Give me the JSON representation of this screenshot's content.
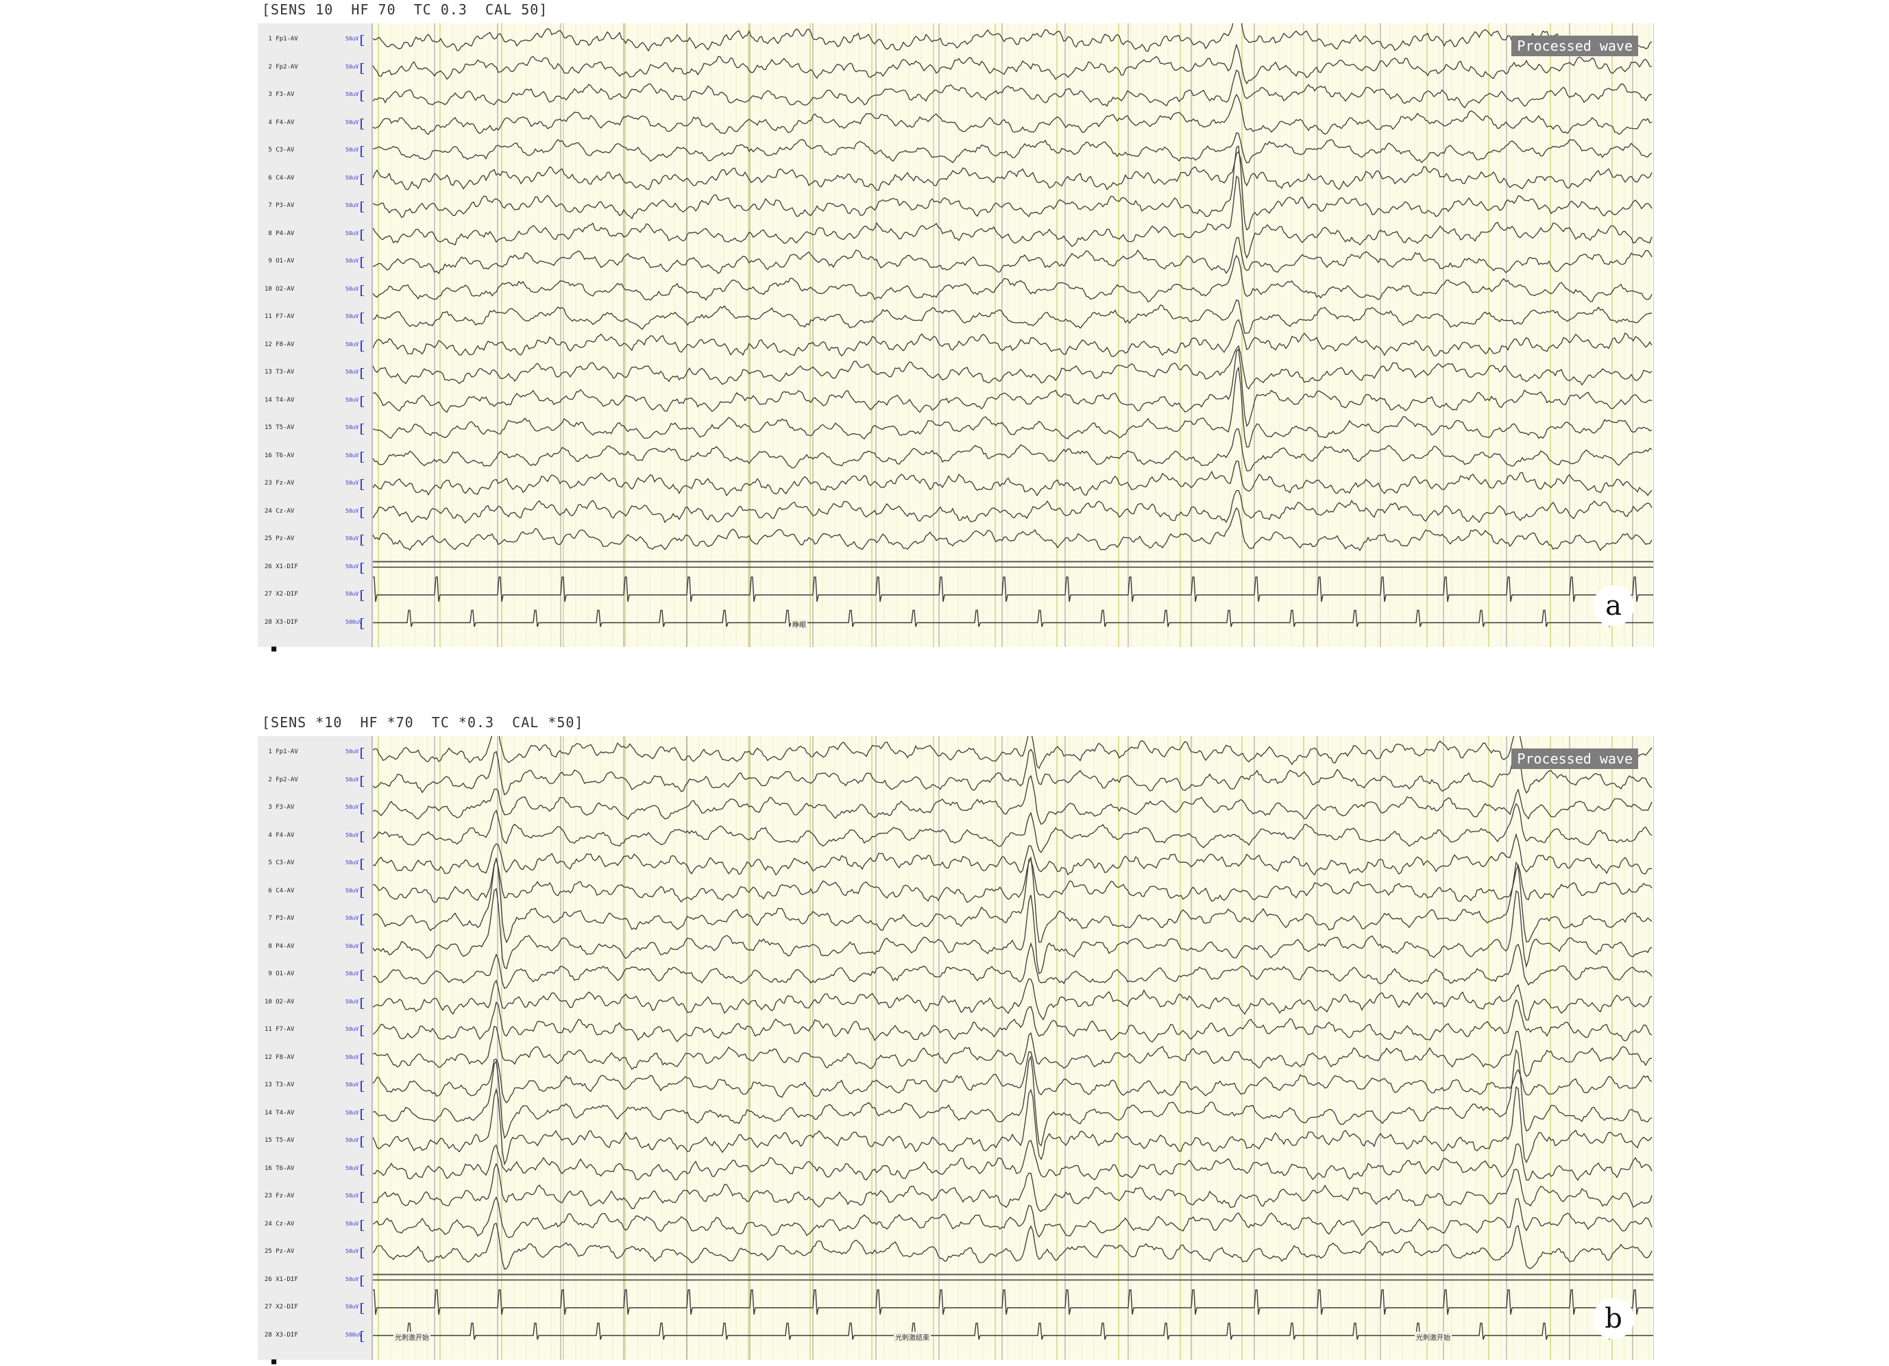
{
  "panels": [
    {
      "id": "a",
      "settings": "[SENS 10  HF 70  TC 0.3  CAL 50]",
      "badge": "Processed wave",
      "letter": "a",
      "channels": [
        {
          "num": "1",
          "name": "Fp1-AV",
          "sens": "50uV"
        },
        {
          "num": "2",
          "name": "Fp2-AV",
          "sens": "50uV"
        },
        {
          "num": "3",
          "name": "F3-AV",
          "sens": "50uV"
        },
        {
          "num": "4",
          "name": "F4-AV",
          "sens": "50uV"
        },
        {
          "num": "5",
          "name": "C3-AV",
          "sens": "50uV"
        },
        {
          "num": "6",
          "name": "C4-AV",
          "sens": "50uV"
        },
        {
          "num": "7",
          "name": "P3-AV",
          "sens": "50uV"
        },
        {
          "num": "8",
          "name": "P4-AV",
          "sens": "50uV"
        },
        {
          "num": "9",
          "name": "O1-AV",
          "sens": "50uV"
        },
        {
          "num": "10",
          "name": "O2-AV",
          "sens": "50uV"
        },
        {
          "num": "11",
          "name": "F7-AV",
          "sens": "50uV"
        },
        {
          "num": "12",
          "name": "F8-AV",
          "sens": "50uV"
        },
        {
          "num": "13",
          "name": "T3-AV",
          "sens": "50uV"
        },
        {
          "num": "14",
          "name": "T4-AV",
          "sens": "50uV"
        },
        {
          "num": "15",
          "name": "T5-AV",
          "sens": "50uV"
        },
        {
          "num": "16",
          "name": "T6-AV",
          "sens": "50uV"
        },
        {
          "num": "23",
          "name": "Fz-AV",
          "sens": "50uV"
        },
        {
          "num": "24",
          "name": "Cz-AV",
          "sens": "50uV"
        },
        {
          "num": "25",
          "name": "Pz-AV",
          "sens": "50uV"
        },
        {
          "num": "26",
          "name": "X1-DIF",
          "sens": "50uV"
        },
        {
          "num": "27",
          "name": "X2-DIF",
          "sens": "50uV"
        },
        {
          "num": "28",
          "name": "X3-DIF",
          "sens": "500uV"
        }
      ],
      "end_mark": "■",
      "event_labels": [
        "睁眼"
      ]
    },
    {
      "id": "b",
      "settings": "[SENS *10  HF *70  TC *0.3  CAL *50]",
      "badge": "Processed wave",
      "letter": "b",
      "channels": [
        {
          "num": "1",
          "name": "Fp1-AV",
          "sens": "50uV"
        },
        {
          "num": "2",
          "name": "Fp2-AV",
          "sens": "50uV"
        },
        {
          "num": "3",
          "name": "F3-AV",
          "sens": "50uV"
        },
        {
          "num": "4",
          "name": "F4-AV",
          "sens": "50uV"
        },
        {
          "num": "5",
          "name": "C3-AV",
          "sens": "50uV"
        },
        {
          "num": "6",
          "name": "C4-AV",
          "sens": "50uV"
        },
        {
          "num": "7",
          "name": "P3-AV",
          "sens": "50uV"
        },
        {
          "num": "8",
          "name": "P4-AV",
          "sens": "50uV"
        },
        {
          "num": "9",
          "name": "O1-AV",
          "sens": "50uV"
        },
        {
          "num": "10",
          "name": "O2-AV",
          "sens": "50uV"
        },
        {
          "num": "11",
          "name": "F7-AV",
          "sens": "50uV"
        },
        {
          "num": "12",
          "name": "F8-AV",
          "sens": "50uV"
        },
        {
          "num": "13",
          "name": "T3-AV",
          "sens": "50uV"
        },
        {
          "num": "14",
          "name": "T4-AV",
          "sens": "50uV"
        },
        {
          "num": "15",
          "name": "T5-AV",
          "sens": "50uV"
        },
        {
          "num": "16",
          "name": "T6-AV",
          "sens": "50uV"
        },
        {
          "num": "23",
          "name": "Fz-AV",
          "sens": "50uV"
        },
        {
          "num": "24",
          "name": "Cz-AV",
          "sens": "50uV"
        },
        {
          "num": "25",
          "name": "Pz-AV",
          "sens": "50uV"
        },
        {
          "num": "26",
          "name": "X1-DIF",
          "sens": "50uV"
        },
        {
          "num": "27",
          "name": "X2-DIF",
          "sens": "50uV"
        },
        {
          "num": "28",
          "name": "X3-DIF",
          "sens": "500uV"
        }
      ],
      "end_mark": "■",
      "event_labels": [
        "光刺激开始",
        "光刺激结束",
        "光刺激开始"
      ]
    }
  ],
  "colors": {
    "trace": "#3a3a3a",
    "grid_major": "#d9e29a",
    "grid_minor": "#eef0c8",
    "background": "#fbfbe8",
    "sensitivity_text": "#3b3bd6"
  }
}
